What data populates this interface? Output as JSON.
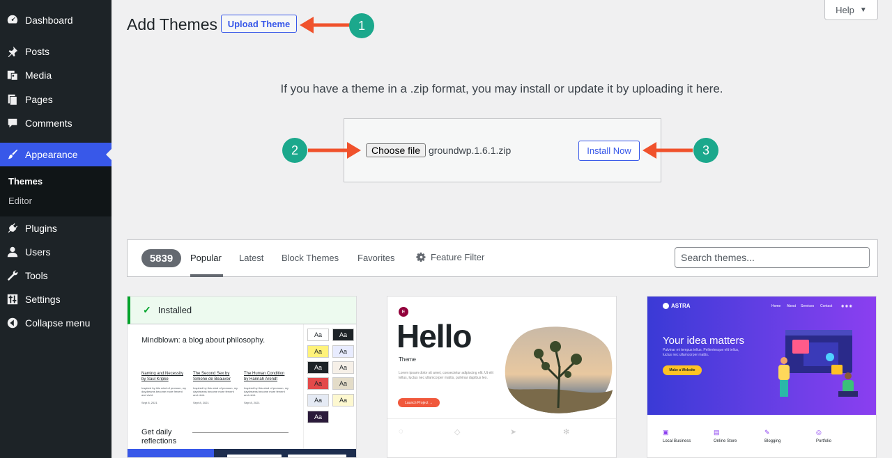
{
  "sidebar": {
    "items": [
      {
        "label": "Dashboard",
        "icon": "dashboard-icon"
      },
      {
        "label": "Posts",
        "icon": "pin-icon"
      },
      {
        "label": "Media",
        "icon": "media-icon"
      },
      {
        "label": "Pages",
        "icon": "pages-icon"
      },
      {
        "label": "Comments",
        "icon": "comment-icon"
      },
      {
        "label": "Appearance",
        "icon": "paintbrush-icon"
      },
      {
        "label": "Plugins",
        "icon": "plugin-icon"
      },
      {
        "label": "Users",
        "icon": "user-icon"
      },
      {
        "label": "Tools",
        "icon": "wrench-icon"
      },
      {
        "label": "Settings",
        "icon": "settings-icon"
      },
      {
        "label": "Collapse menu",
        "icon": "collapse-icon"
      }
    ],
    "submenu": [
      {
        "label": "Themes",
        "current": true
      },
      {
        "label": "Editor",
        "current": false
      }
    ]
  },
  "header": {
    "title": "Add Themes",
    "upload_label": "Upload Theme",
    "help_label": "Help"
  },
  "upload": {
    "description": "If you have a theme in a .zip format, you may install or update it by uploading it here.",
    "choose_label": "Choose file",
    "file_name": "groundwp.1.6.1.zip",
    "install_label": "Install Now"
  },
  "annotations": {
    "one": "1",
    "two": "2",
    "three": "3"
  },
  "filter": {
    "count": "5839",
    "tabs": [
      "Popular",
      "Latest",
      "Block Themes",
      "Favorites"
    ],
    "feature_filter": "Feature Filter",
    "search_placeholder": "Search themes..."
  },
  "themes": {
    "t1": {
      "installed": "Installed",
      "blog_title": "Mindblown: a blog about philosophy.",
      "col1_title": "Naming and Necessity by Saul Kripke",
      "col2_title": "The Second Sex by Simone de Beauvoir",
      "col3_title": "The Human Condition by Hannah Arendt",
      "col_text": "Inspired by this wind of pronoun, my daydreams become more fervent and vivid.",
      "col1_date": "Sept 8, 2021",
      "col2_date": "Sept 8, 2021",
      "col3_date": "Sept 8, 2021",
      "daily": "Get daily reflections",
      "swatch": "Aa"
    },
    "t2": {
      "logo": "E",
      "big": "Hello",
      "sub": "Theme",
      "text": "Lorem ipsum dolor sit amet, consectetur adipiscing elit. Ut elit tellus, luctus nec ullamcorper mattis, pulvinar dapibus leo.",
      "cta": "Launch Project →"
    },
    "t3": {
      "logo": "ASTRA",
      "nav": [
        "Home",
        "About",
        "Services",
        "Contact"
      ],
      "heading": "Your idea matters",
      "text": "Pulvinar mi tempus tellus. Pellentesque elit tellus, luctus nec ullamcorper mattis.",
      "button": "Make a Website",
      "features": [
        "Local Business",
        "Online Store",
        "Blogging",
        "Portfolio"
      ]
    }
  },
  "colors": {
    "accent": "#3858e9",
    "annotation_arrow": "#f0522c",
    "annotation_badge": "#1ba88c"
  }
}
